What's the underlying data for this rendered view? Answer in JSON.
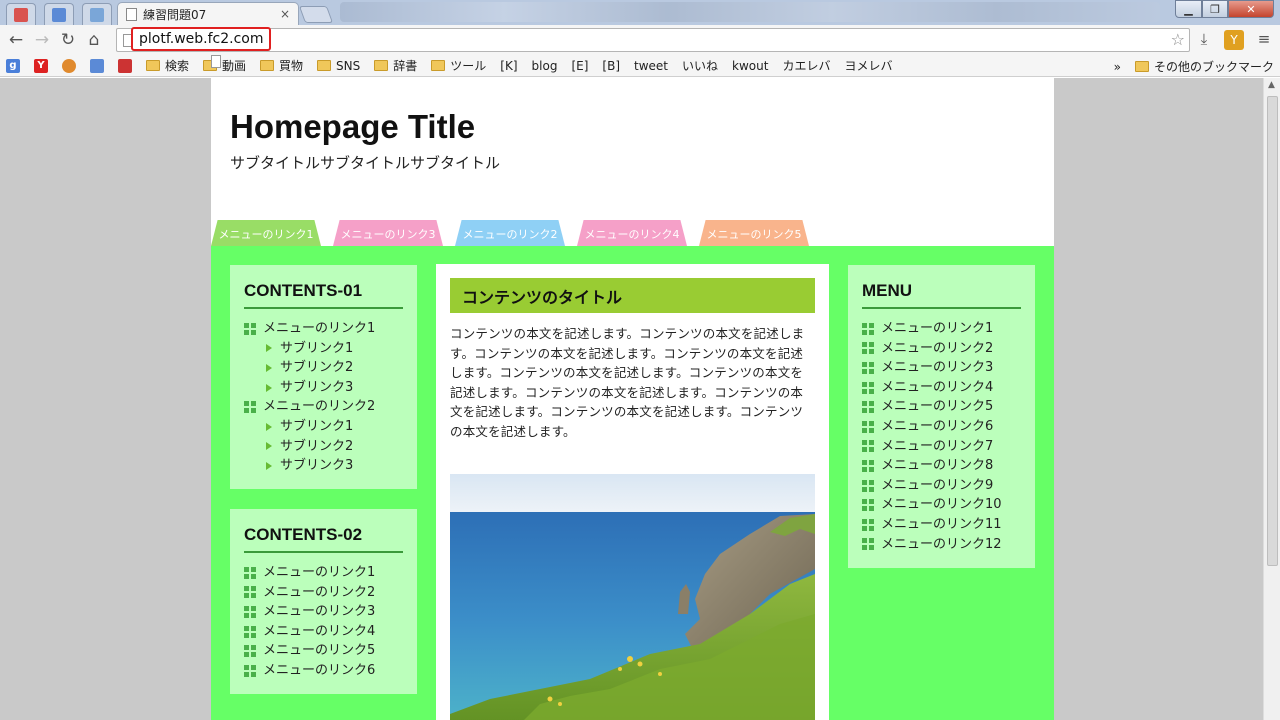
{
  "browser": {
    "tab_title": "練習問題07",
    "tab_close": "×",
    "url": "plotf.web.fc2.com",
    "bookmarks": [
      "検索",
      "動画",
      "買物",
      "SNS",
      "辞書",
      "ツール",
      "[K]",
      "blog",
      "[E]",
      "[B]",
      "tweet",
      "いいね",
      "kwout",
      "カエレバ",
      "ヨメレバ"
    ],
    "bookmarks_overflow": "»",
    "other_bookmarks": "その他のブックマーク"
  },
  "site": {
    "title": "Homepage Title",
    "subtitle": "サブタイトルサブタイトルサブタイトル",
    "nav_tabs": [
      {
        "label": "メニューのリンク1",
        "color": "#99dd66"
      },
      {
        "label": "メニューのリンク3",
        "color": "#f5a0c8"
      },
      {
        "label": "メニューのリンク2",
        "color": "#8fd0f5"
      },
      {
        "label": "メニューのリンク4",
        "color": "#f5a0c8"
      },
      {
        "label": "メニューのリンク5",
        "color": "#f9b48c"
      }
    ],
    "contents01": {
      "heading": "CONTENTS-01",
      "items": [
        "メニューのリンク1",
        "サブリンク1",
        "サブリンク2",
        "サブリンク3",
        "メニューのリンク2",
        "サブリンク1",
        "サブリンク2",
        "サブリンク3"
      ]
    },
    "contents02": {
      "heading": "CONTENTS-02",
      "items": [
        "メニューのリンク1",
        "メニューのリンク2",
        "メニューのリンク3",
        "メニューのリンク4",
        "メニューのリンク5",
        "メニューのリンク6"
      ]
    },
    "main": {
      "heading": "コンテンツのタイトル",
      "body": "コンテンツの本文を記述します。コンテンツの本文を記述します。コンテンツの本文を記述します。コンテンツの本文を記述します。コンテンツの本文を記述します。コンテンツの本文を記述します。コンテンツの本文を記述します。コンテンツの本文を記述します。コンテンツの本文を記述します。コンテンツの本文を記述します。"
    },
    "menu": {
      "heading": "MENU",
      "items": [
        "メニューのリンク1",
        "メニューのリンク2",
        "メニューのリンク3",
        "メニューのリンク4",
        "メニューのリンク5",
        "メニューのリンク6",
        "メニューのリンク7",
        "メニューのリンク8",
        "メニューのリンク9",
        "メニューのリンク10",
        "メニューのリンク11",
        "メニューのリンク12"
      ]
    }
  }
}
